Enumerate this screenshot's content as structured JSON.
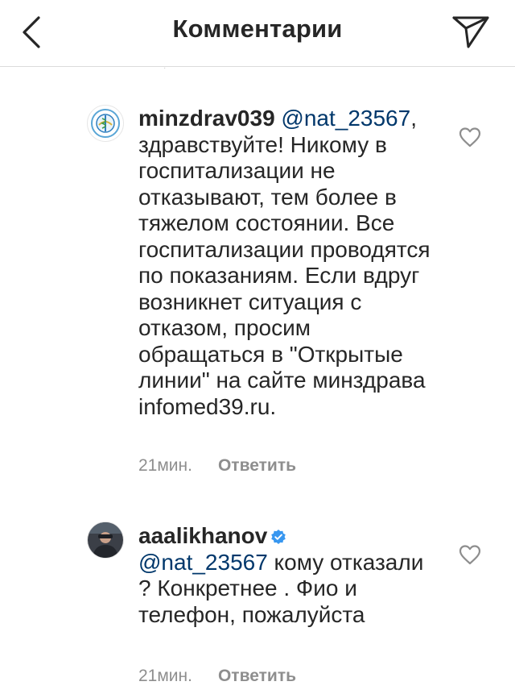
{
  "header": {
    "title": "Комментарии",
    "back_icon": "chevron-left-icon",
    "send_icon": "direct-send-icon"
  },
  "comments": [
    {
      "username": "minzdrav039",
      "verified": false,
      "mention": "@nat_23567",
      "text": ", здравствуйте! Никому в госпитализации не отказывают, тем более в тяжелом состоянии. Все госпитализации проводятся по показаниям. Если вдруг возникнет ситуация с отказом, просим обращаться в \"Открытые линии\" на сайте минздрава infomed39.ru.",
      "time": "21мин.",
      "reply_label": "Ответить",
      "like_icon": "heart-outline-icon"
    },
    {
      "username": "aaalikhanov",
      "verified": true,
      "mention": "@nat_23567",
      "text": " кому отказали ? Конкретнее . Фио и телефон, пожалуйста",
      "time": "21мин.",
      "reply_label": "Ответить",
      "like_icon": "heart-outline-icon"
    }
  ],
  "colors": {
    "mention": "#00376b",
    "meta": "#8e8e8e",
    "verified": "#3897f0"
  }
}
